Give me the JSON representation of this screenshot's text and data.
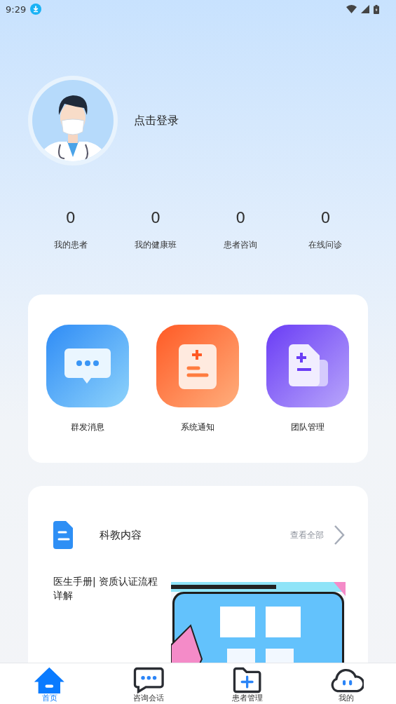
{
  "status_bar": {
    "time": "9:29"
  },
  "profile": {
    "login_text": "点击登录"
  },
  "stats": [
    {
      "value": "0",
      "label": "我的患者"
    },
    {
      "value": "0",
      "label": "我的健康班"
    },
    {
      "value": "0",
      "label": "患者咨询"
    },
    {
      "value": "0",
      "label": "在线问诊"
    }
  ],
  "tools": [
    {
      "kind": "message",
      "label": "群发消息"
    },
    {
      "kind": "notice",
      "label": "系统通知"
    },
    {
      "kind": "team",
      "label": "团队管理"
    }
  ],
  "education": {
    "title": "科教内容",
    "more": "查看全部",
    "articles": [
      {
        "title": "医生手册| 资质认证流程详解"
      }
    ]
  },
  "nav": [
    {
      "kind": "home",
      "label": "首页",
      "selected": true
    },
    {
      "kind": "chat",
      "label": "咨询会话",
      "selected": false
    },
    {
      "kind": "patients",
      "label": "患者管理",
      "selected": false
    },
    {
      "kind": "mine",
      "label": "我的",
      "selected": false
    }
  ]
}
